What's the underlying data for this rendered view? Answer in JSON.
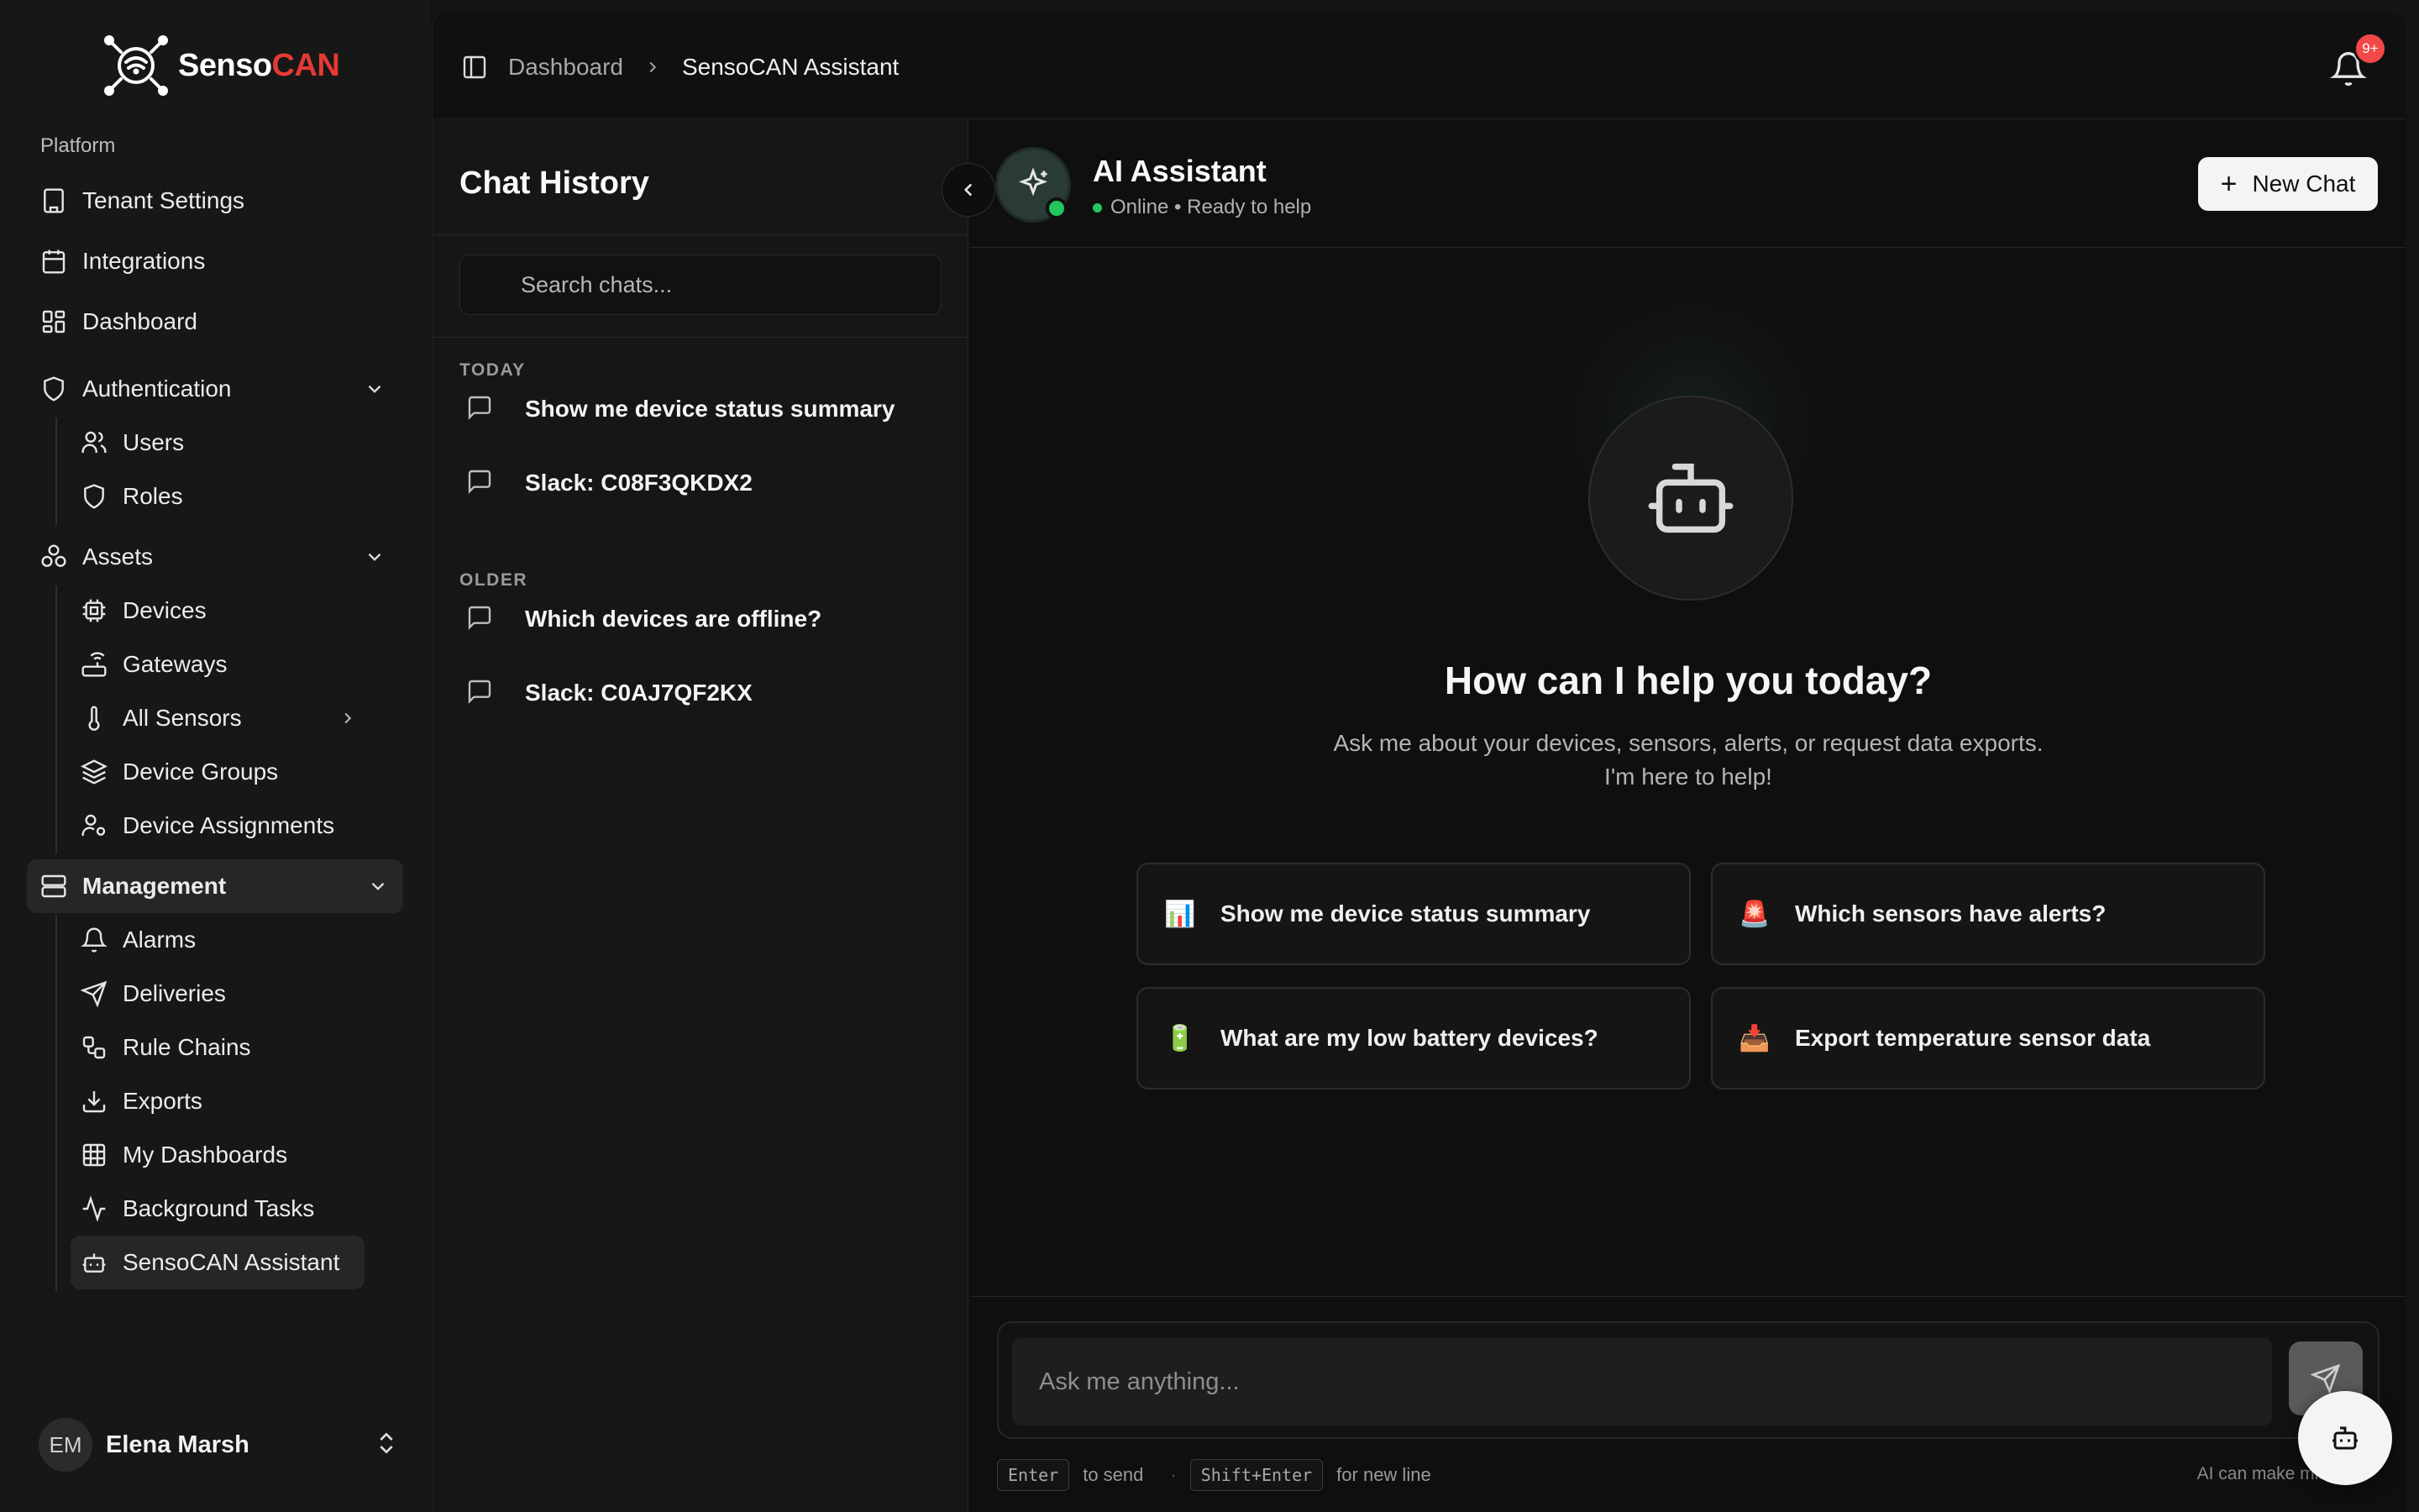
{
  "app": {
    "logo_prefix": "Senso",
    "logo_accent": "CAN",
    "brand_accent_color": "#e53935"
  },
  "sidebar": {
    "section_label": "Platform",
    "items": [
      {
        "label": "Tenant Settings",
        "icon": "building-icon"
      },
      {
        "label": "Integrations",
        "icon": "calendar-icon"
      },
      {
        "label": "Dashboard",
        "icon": "layout-dashboard-icon"
      }
    ],
    "groups": [
      {
        "label": "Authentication",
        "icon": "shield-icon",
        "expanded": true,
        "children": [
          {
            "label": "Users",
            "icon": "users-icon"
          },
          {
            "label": "Roles",
            "icon": "shield-icon"
          }
        ]
      },
      {
        "label": "Assets",
        "icon": "boxes-icon",
        "expanded": true,
        "children": [
          {
            "label": "Devices",
            "icon": "cpu-icon"
          },
          {
            "label": "Gateways",
            "icon": "router-icon"
          },
          {
            "label": "All Sensors",
            "icon": "thermometer-icon"
          },
          {
            "label": "Device Groups",
            "icon": "layers-icon"
          },
          {
            "label": "Device Assignments",
            "icon": "user-cog-icon"
          }
        ]
      },
      {
        "label": "Management",
        "icon": "server-icon",
        "expanded": true,
        "children": [
          {
            "label": "Alarms",
            "icon": "bell-icon"
          },
          {
            "label": "Deliveries",
            "icon": "send-icon"
          },
          {
            "label": "Rule Chains",
            "icon": "workflow-icon"
          },
          {
            "label": "Exports",
            "icon": "download-icon"
          },
          {
            "label": "My Dashboards",
            "icon": "table-grid-icon"
          },
          {
            "label": "Background Tasks",
            "icon": "activity-icon"
          },
          {
            "label": "SensoCAN Assistant",
            "icon": "bot-icon"
          }
        ]
      }
    ],
    "user": {
      "initials": "EM",
      "name": "Elena Marsh"
    }
  },
  "header": {
    "breadcrumb": [
      "Dashboard",
      "SensoCAN Assistant"
    ],
    "notification_badge": "9+",
    "badge_color": "#f24848"
  },
  "history": {
    "title": "Chat History",
    "search_placeholder": "Search chats...",
    "groups": [
      {
        "label": "TODAY",
        "items": [
          "Show me device status summary",
          "Slack: C08F3QKDX2"
        ]
      },
      {
        "label": "OLDER",
        "items": [
          "Which devices are offline?",
          "Slack: C0AJ7QF2KX"
        ]
      }
    ]
  },
  "chat": {
    "assistant_name": "AI Assistant",
    "status": "Online • Ready to help",
    "status_color": "#22c55e",
    "new_chat_label": "New Chat",
    "welcome_title": "How can I help you today?",
    "welcome_sub_line1": "Ask me about your devices, sensors, alerts, or request data exports.",
    "welcome_sub_line2": "I'm here to help!",
    "suggestions": [
      {
        "emoji": "📊",
        "label": "Show me device status summary"
      },
      {
        "emoji": "🚨",
        "label": "Which sensors have alerts?"
      },
      {
        "emoji": "🔋",
        "label": "What are my low battery devices?"
      },
      {
        "emoji": "📥",
        "label": "Export temperature sensor data"
      }
    ],
    "composer_placeholder": "Ask me anything...",
    "hint_send_key": "Enter",
    "hint_send_text": "to send",
    "hint_newline_key": "Shift+Enter",
    "hint_newline_text": "for new line",
    "disclaimer": "AI can make mistakes"
  }
}
